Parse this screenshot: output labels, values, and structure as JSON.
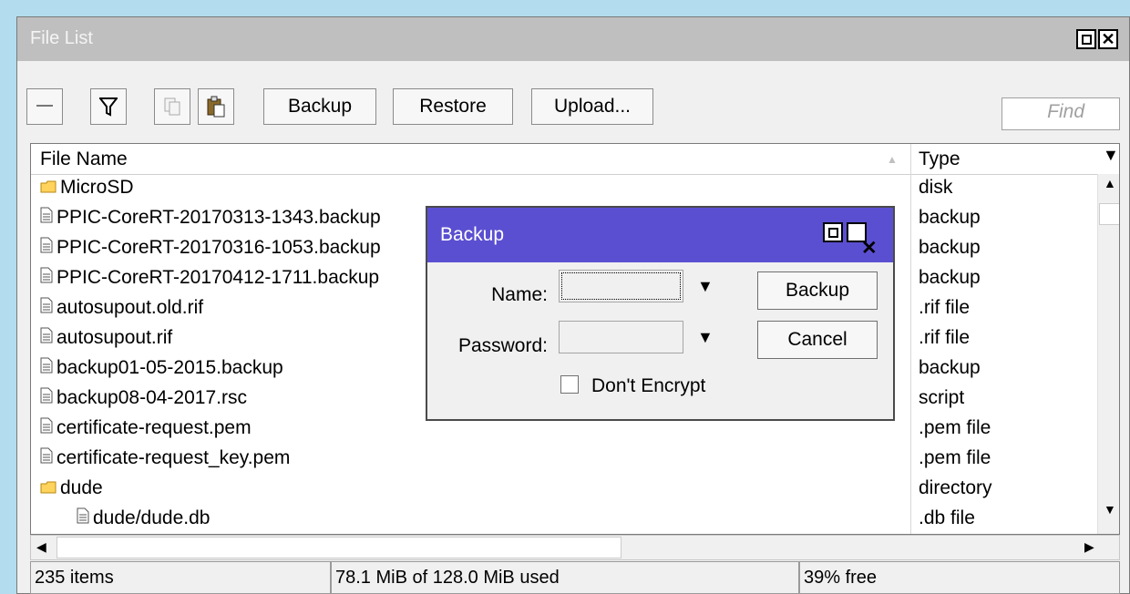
{
  "window": {
    "title": "File List",
    "maximize_icon": "maximize-icon",
    "close_icon": "close-icon"
  },
  "toolbar": {
    "backup_label": "Backup",
    "restore_label": "Restore",
    "upload_label": "Upload...",
    "find_placeholder": "Find"
  },
  "table": {
    "columns": {
      "name": "File Name",
      "type": "Type"
    },
    "rows": [
      {
        "name": "MicroSD",
        "type": "disk",
        "icon": "folder-icon"
      },
      {
        "name": "PPIC-CoreRT-20170313-1343.backup",
        "type": "backup",
        "icon": "file-icon"
      },
      {
        "name": "PPIC-CoreRT-20170316-1053.backup",
        "type": "backup",
        "icon": "file-icon"
      },
      {
        "name": "PPIC-CoreRT-20170412-1711.backup",
        "type": "backup",
        "icon": "file-icon"
      },
      {
        "name": "autosupout.old.rif",
        "type": ".rif file",
        "icon": "file-icon"
      },
      {
        "name": "autosupout.rif",
        "type": ".rif file",
        "icon": "file-icon"
      },
      {
        "name": "backup01-05-2015.backup",
        "type": "backup",
        "icon": "file-icon"
      },
      {
        "name": "backup08-04-2017.rsc",
        "type": "script",
        "icon": "file-icon"
      },
      {
        "name": "certificate-request.pem",
        "type": ".pem file",
        "icon": "file-icon"
      },
      {
        "name": "certificate-request_key.pem",
        "type": ".pem file",
        "icon": "file-icon"
      },
      {
        "name": "dude",
        "type": "directory",
        "icon": "folder-icon"
      },
      {
        "name": "dude/dude.db",
        "type": ".db file",
        "icon": "file-icon"
      }
    ]
  },
  "status": {
    "items": "235 items",
    "used": "78.1 MiB of 128.0 MiB used",
    "free": "39% free"
  },
  "dialog": {
    "title": "Backup",
    "name_label": "Name:",
    "password_label": "Password:",
    "dont_encrypt_label": "Don't Encrypt",
    "dont_encrypt_checked": false,
    "backup_button": "Backup",
    "cancel_button": "Cancel"
  },
  "colors": {
    "dialog_title_bg": "#5b4fd1",
    "desktop_bg": "#b3dcef"
  }
}
